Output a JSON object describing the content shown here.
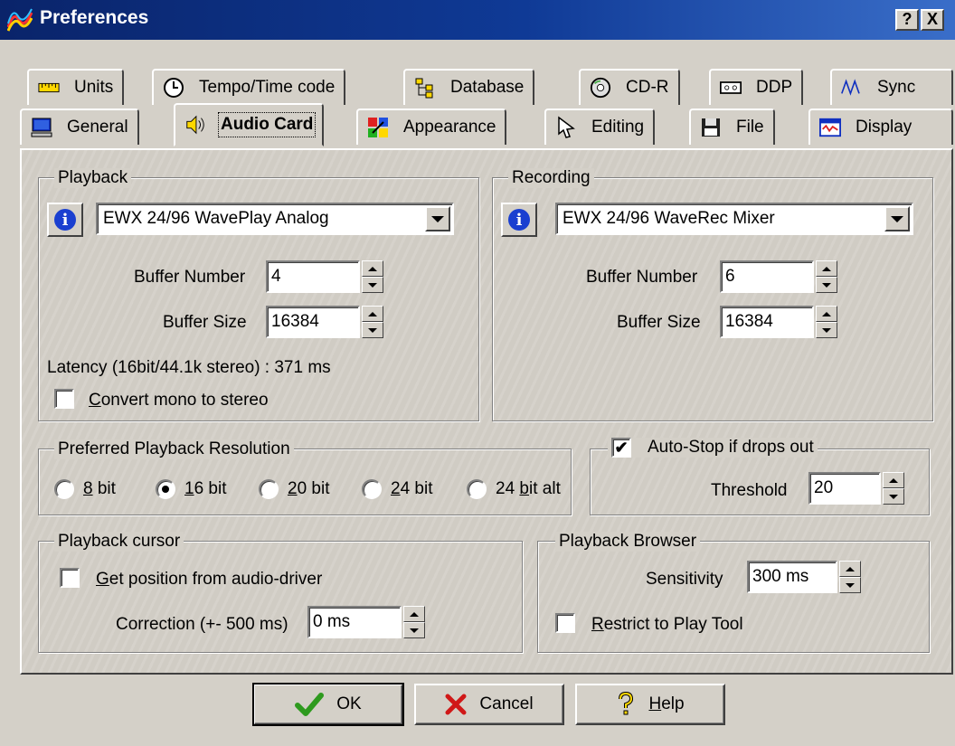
{
  "window": {
    "title": "Preferences",
    "help_btn": "?",
    "close_btn": "X"
  },
  "tabs_row1": [
    {
      "label": "Units",
      "icon": "ruler-icon"
    },
    {
      "label": "Tempo/Time code",
      "icon": "clock-icon"
    },
    {
      "label": "Database",
      "icon": "tree-icon"
    },
    {
      "label": "CD-R",
      "icon": "cd-icon"
    },
    {
      "label": "DDP",
      "icon": "tape-icon"
    },
    {
      "label": "Sync",
      "icon": "waveform-icon"
    }
  ],
  "tabs_row2": [
    {
      "label": "General",
      "icon": "computer-icon"
    },
    {
      "label": "Audio Card",
      "icon": "speaker-icon",
      "active": true
    },
    {
      "label": "Appearance",
      "icon": "palette-icon"
    },
    {
      "label": "Editing",
      "icon": "pointer-icon"
    },
    {
      "label": "File",
      "icon": "floppy-icon"
    },
    {
      "label": "Display",
      "icon": "display-icon"
    }
  ],
  "playback": {
    "legend": "Playback",
    "device": "EWX 24/96 WavePlay Analog",
    "buffer_number_label": "Buffer Number",
    "buffer_number": "4",
    "buffer_size_label": "Buffer Size",
    "buffer_size": "16384",
    "latency": "Latency (16bit/44.1k stereo) : 371 ms",
    "convert_mono": {
      "label": "Convert mono to stereo",
      "checked": false
    }
  },
  "recording": {
    "legend": "Recording",
    "device": "EWX 24/96 WaveRec Mixer",
    "buffer_number_label": "Buffer Number",
    "buffer_number": "6",
    "buffer_size_label": "Buffer Size",
    "buffer_size": "16384"
  },
  "resolution": {
    "legend": "Preferred Playback Resolution",
    "options": [
      {
        "label": "8 bit",
        "selected": false
      },
      {
        "label": "16 bit",
        "selected": true
      },
      {
        "label": "20 bit",
        "selected": false
      },
      {
        "label": "24 bit",
        "selected": false
      },
      {
        "label": "24 bit alt",
        "selected": false
      }
    ]
  },
  "autostop": {
    "label": "Auto-Stop if drops out",
    "checked": true,
    "threshold_label": "Threshold",
    "threshold": "20"
  },
  "cursor": {
    "legend": "Playback cursor",
    "get_position": {
      "label": "Get position from audio-driver",
      "checked": false
    },
    "correction_label": "Correction (+- 500 ms)",
    "correction": "0 ms"
  },
  "browser": {
    "legend": "Playback Browser",
    "sensitivity_label": "Sensitivity",
    "sensitivity": "300 ms",
    "restrict": {
      "label": "Restrict to Play Tool",
      "checked": false
    }
  },
  "buttons": {
    "ok": "OK",
    "cancel": "Cancel",
    "help": "Help"
  },
  "colors": {
    "titlebar": "#0a246a",
    "face": "#d4d0c8",
    "info": "#1a3fd0",
    "ok_check": "#2e9a1e",
    "cancel_x": "#d01818"
  }
}
